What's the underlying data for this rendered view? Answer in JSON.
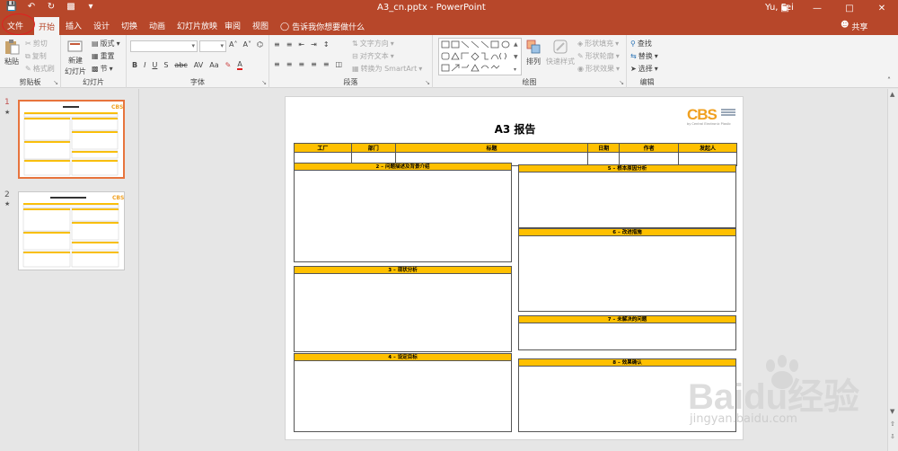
{
  "titlebar": {
    "document_title": "A3_cn.pptx  -  PowerPoint",
    "user": "Yu, Fei",
    "qat_icons": [
      "save-icon",
      "undo-icon",
      "redo-icon",
      "slideshow-icon",
      "customize-icon"
    ],
    "colors": {
      "accent": "#b7472a"
    }
  },
  "tabs": [
    "文件",
    "开始",
    "插入",
    "设计",
    "切换",
    "动画",
    "幻灯片放映",
    "审阅",
    "视图"
  ],
  "tell_me": "告诉我你想要做什么",
  "share": "共享",
  "ribbon": {
    "clipboard": {
      "label": "剪贴板",
      "paste": "粘贴",
      "cut": "剪切",
      "copy": "复制",
      "format_painter": "格式刷"
    },
    "slides": {
      "label": "幻灯片",
      "new_slide": "新建",
      "new_slide_2": "幻灯片",
      "layout": "版式",
      "reset": "重置",
      "section": "节"
    },
    "font": {
      "label": "字体"
    },
    "paragraph": {
      "label": "段落",
      "text_direction": "文字方向",
      "align_text": "对齐文本",
      "smartart": "转换为 SmartArt"
    },
    "drawing": {
      "label": "绘图",
      "arrange": "排列",
      "quick_styles": "快速样式",
      "shape_fill": "形状填充",
      "shape_outline": "形状轮廓",
      "shape_effects": "形状效果"
    },
    "editing": {
      "label": "编辑",
      "find": "查找",
      "replace": "替换",
      "select": "选择"
    }
  },
  "thumbnails": [
    {
      "number": "1",
      "mark": "★"
    },
    {
      "number": "2",
      "mark": "★"
    }
  ],
  "slide": {
    "title": "A3 报告",
    "logo": {
      "text": "CBS",
      "tagline": "by Central Electronic Plastic"
    },
    "header_columns": [
      "工厂",
      "部门",
      "标题",
      "日期",
      "作者",
      "发起人"
    ],
    "sections": {
      "s2": "2 – 问题描述及背景介绍",
      "s3": "3 – 现状分析",
      "s4": "4 – 设定目标",
      "s5": "5 – 根本原因分析",
      "s6": "6 – 改进措施",
      "s7": "7 – 未解决的问题",
      "s8": "8 – 效果确认"
    },
    "colors": {
      "section_bar": "#ffc000"
    }
  },
  "watermark": {
    "text": "Baidu经验",
    "sub": "jingyan.baidu.com"
  }
}
